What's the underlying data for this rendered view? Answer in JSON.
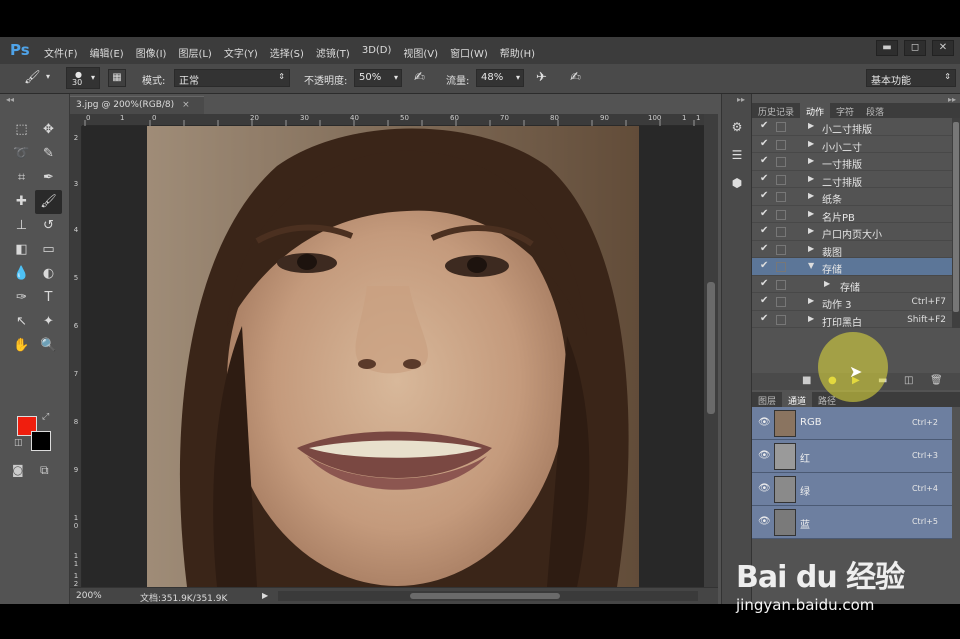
{
  "menubar": {
    "logo": "Ps",
    "items": [
      "文件(F)",
      "编辑(E)",
      "图像(I)",
      "图层(L)",
      "文字(Y)",
      "选择(S)",
      "滤镜(T)",
      "3D(D)",
      "视图(V)",
      "窗口(W)",
      "帮助(H)"
    ],
    "window_buttons": [
      "▬",
      "◻",
      "✕"
    ]
  },
  "options": {
    "brush_size": "30",
    "mode_label": "模式:",
    "mode_value": "正常",
    "opacity_label": "不透明度:",
    "opacity_value": "50%",
    "flow_label": "流量:",
    "flow_value": "48%",
    "workspace": "基本功能"
  },
  "document": {
    "tab_title": "3.jpg @ 200%(RGB/8)",
    "close_glyph": "×",
    "ruler_h": [
      "0",
      "1",
      "0",
      "20",
      "30",
      "40",
      "50",
      "60",
      "70",
      "80",
      "90",
      "100",
      "1",
      "1"
    ],
    "ruler_v": [
      "2",
      "3",
      "4",
      "5",
      "6",
      "7",
      "8",
      "9",
      "1 0",
      "1 1",
      "1 2"
    ]
  },
  "status": {
    "zoom": "200%",
    "doc_size": "文档:351.9K/351.9K"
  },
  "panel": {
    "top_tabs": [
      "历史记录",
      "动作",
      "字符",
      "段落"
    ],
    "actions": [
      {
        "label": "小二寸排版",
        "shortcut": ""
      },
      {
        "label": "小小二寸",
        "shortcut": ""
      },
      {
        "label": "一寸排版",
        "shortcut": ""
      },
      {
        "label": "二寸排版",
        "shortcut": ""
      },
      {
        "label": "纸条",
        "shortcut": ""
      },
      {
        "label": "名片PB",
        "shortcut": ""
      },
      {
        "label": "户口内页大小",
        "shortcut": ""
      },
      {
        "label": "裁图",
        "shortcut": ""
      },
      {
        "label": "存储",
        "shortcut": ""
      },
      {
        "label": "存储",
        "shortcut": ""
      },
      {
        "label": "动作 3",
        "shortcut": "Ctrl+F7"
      },
      {
        "label": "打印黑白",
        "shortcut": "Shift+F2"
      }
    ],
    "bottom_tabs": [
      "图层",
      "通道",
      "路径"
    ],
    "channels": [
      {
        "label": "RGB",
        "shortcut": "Ctrl+2"
      },
      {
        "label": "红",
        "shortcut": "Ctrl+3"
      },
      {
        "label": "绿",
        "shortcut": "Ctrl+4"
      },
      {
        "label": "蓝",
        "shortcut": "Ctrl+5"
      }
    ]
  },
  "watermark": {
    "logo": "Bai du 经验",
    "url": "jingyan.baidu.com"
  },
  "colors": {
    "foreground": "#f01e0e",
    "background": "#000000",
    "selection": "#5c7698",
    "channel_row": "#6d7fa0"
  }
}
